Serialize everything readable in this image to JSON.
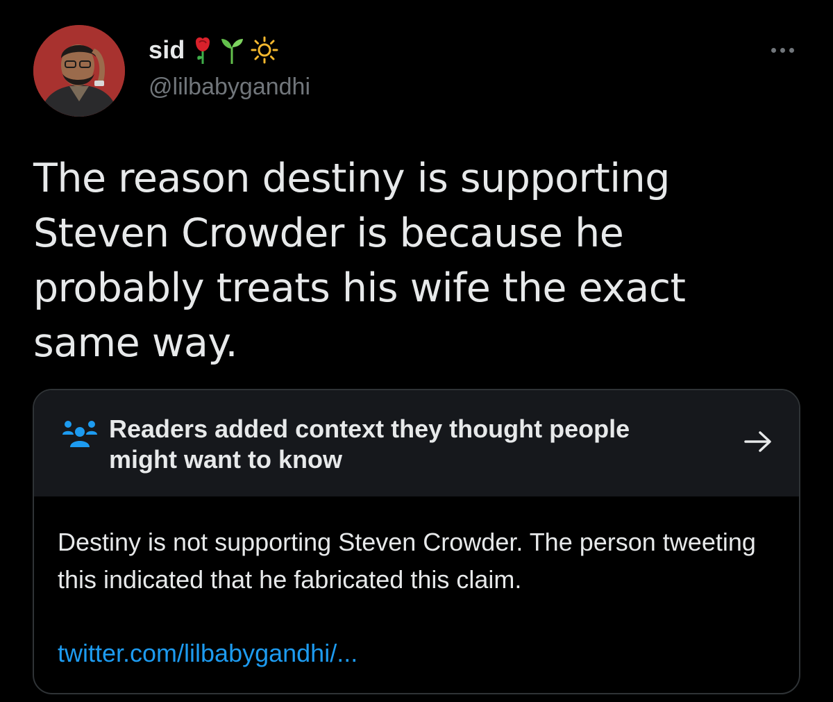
{
  "author": {
    "display_name": "sid",
    "name_emojis": [
      "rose-emoji",
      "seedling-emoji",
      "sun-emoji"
    ],
    "handle": "@lilbabygandhi"
  },
  "tweet": {
    "text": "The reason destiny is supporting\nSteven Crowder is because he\nprobably treats his wife the exact\nsame way."
  },
  "community_note": {
    "title": "Readers added context they thought people might want to know",
    "body": "Destiny is not supporting Steven Crowder. The person tweeting this indicated that he fabricated this claim.",
    "link": "twitter.com/lilbabygandhi/..."
  },
  "colors": {
    "background": "#000000",
    "text": "#e7e9ea",
    "secondary": "#71767b",
    "accent": "#1d9bf0",
    "note_header_bg": "#16181c",
    "border": "#2f3336"
  }
}
